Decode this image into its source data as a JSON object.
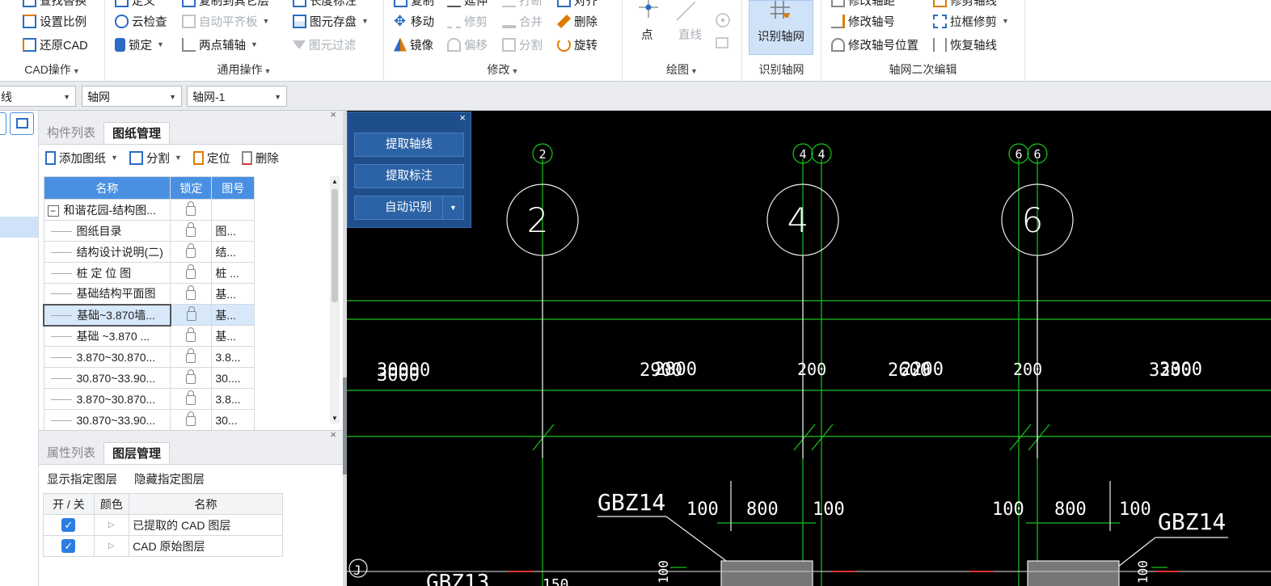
{
  "ribbon": {
    "cad": {
      "title": "CAD操作",
      "top_item": "查找替换",
      "items": [
        "设置比例",
        "还原CAD"
      ]
    },
    "general": {
      "title": "通用操作",
      "col1_top": "定义",
      "col1": [
        "云检查",
        "锁定"
      ],
      "col2_top": "复制到其它层",
      "col2": [
        "自动平齐板",
        "两点辅轴"
      ],
      "col3_top": "长度标注",
      "col3": [
        "图元存盘",
        "图元过滤"
      ]
    },
    "modify": {
      "title": "修改",
      "top_items": [
        "复制",
        "延伸",
        "打断",
        "对齐"
      ],
      "row1": [
        "移动",
        "修剪",
        "合并",
        "删除"
      ],
      "row2": [
        "镜像",
        "偏移",
        "分割",
        "旋转"
      ]
    },
    "draw": {
      "title": "绘图",
      "point": "点",
      "line": "直线"
    },
    "recognize": {
      "title": "识别轴网",
      "button": "识别轴网"
    },
    "axis_edit": {
      "title": "轴网二次编辑",
      "top_items": [
        "修改轴距",
        "修剪轴线"
      ],
      "col1": [
        "修改轴号",
        "修改轴号位置"
      ],
      "col2": [
        "拉框修剪",
        "恢复轴线"
      ]
    }
  },
  "toolbar": {
    "select1": "线",
    "select2": "轴网",
    "select3": "轴网-1"
  },
  "drawing_panel": {
    "tabs": [
      "构件列表",
      "图纸管理"
    ],
    "actions": [
      "添加图纸",
      "分割",
      "定位",
      "删除"
    ],
    "columns": [
      "名称",
      "锁定",
      "图号"
    ],
    "rows": [
      {
        "name": "和谐花园-结构图...",
        "num": ""
      },
      {
        "name": "图纸目录",
        "num": "图..."
      },
      {
        "name": "结构设计说明(二)",
        "num": "结..."
      },
      {
        "name": "桩 定 位 图",
        "num": "桩 ..."
      },
      {
        "name": "基础结构平面图",
        "num": "基..."
      },
      {
        "name": "基础~3.870墙...",
        "num": "基..."
      },
      {
        "name": "基础 ~3.870 ...",
        "num": "基..."
      },
      {
        "name": "3.870~30.870...",
        "num": "3.8..."
      },
      {
        "name": "30.870~33.90...",
        "num": "30...."
      },
      {
        "name": "3.870~30.870...",
        "num": "3.8..."
      },
      {
        "name": "30.870~33.90...",
        "num": "30..."
      }
    ]
  },
  "layer_panel": {
    "tabs": [
      "属性列表",
      "图层管理"
    ],
    "actions": [
      "显示指定图层",
      "隐藏指定图层"
    ],
    "columns": [
      "开 / 关",
      "颜色",
      "名称"
    ],
    "rows": [
      {
        "name": "已提取的 CAD 图层"
      },
      {
        "name": "CAD 原始图层"
      }
    ]
  },
  "float_panel": {
    "buttons": [
      "提取轴线",
      "提取标注",
      "自动识别"
    ]
  },
  "cad": {
    "axis_tags": [
      "2",
      "4",
      "4",
      "6",
      "6"
    ],
    "axis_circles": [
      "2",
      "4",
      "6"
    ],
    "dims": [
      "30000",
      "2900",
      "200",
      "2600",
      "200",
      "3200",
      "3000",
      "2800",
      "2200",
      "3300"
    ],
    "small_dims": [
      "100",
      "800",
      "100",
      "100",
      "800",
      "100"
    ],
    "labels": [
      "GBZ14",
      "GBZ14",
      "GBZ13",
      "J",
      "150",
      "100",
      "100"
    ]
  }
}
